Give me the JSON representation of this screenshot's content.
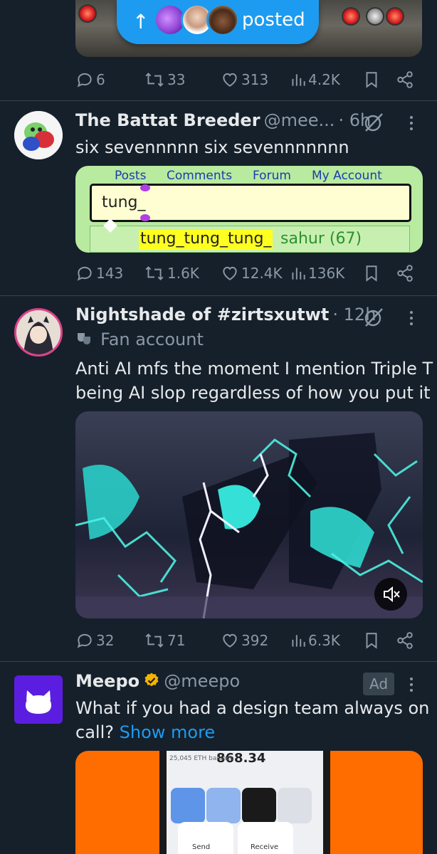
{
  "banner": {
    "label": "posted",
    "arrow": "↑"
  },
  "tweets": [
    {
      "stats": {
        "replies": "6",
        "reposts": "33",
        "likes": "313",
        "views": "4.2K"
      }
    },
    {
      "name": "The Battat Breeder",
      "handle": "@mee...",
      "time": "· 6h",
      "text": "six sevennnnn six sevennnnnnn",
      "embed": {
        "nav": [
          "Posts",
          "Comments",
          "Forum",
          "My Account"
        ],
        "query": "tung_",
        "suggestion_highlight": "tung_tung_tung_",
        "suggestion_rest": "sahur (67)"
      },
      "stats": {
        "replies": "143",
        "reposts": "1.6K",
        "likes": "12.4K",
        "views": "136K"
      }
    },
    {
      "name": "Nightshade of #zirtsxutwt",
      "time": "· 12h",
      "badge": "Fan account",
      "text_line1": "Anti AI mfs the moment I mention Triple T",
      "text_line2": "being AI slop regardless of how you put it",
      "stats": {
        "replies": "32",
        "reposts": "71",
        "likes": "392",
        "views": "6.3K"
      }
    },
    {
      "name": "Meepo",
      "handle": "@meepo",
      "ad": "Ad",
      "text_line1": "What if you had a design team always on",
      "text_line2": "call?",
      "show_more": "Show more",
      "media": {
        "amount": "868.34",
        "balance": "25,045 ETH balance",
        "send": "Send",
        "receive": "Receive"
      }
    }
  ],
  "icons": {
    "reply": "reply-icon",
    "repost": "repost-icon",
    "like": "heart-icon",
    "views": "views-icon",
    "bookmark": "bookmark-icon",
    "share": "share-icon",
    "grok": "grok-icon",
    "more": "more-icon",
    "mute": "mute-icon",
    "verified": "verified-badge-icon"
  },
  "colors": {
    "background": "#15202b",
    "accent": "#1d9bf0",
    "muted": "#8b98a5",
    "divider": "#38444d",
    "verified": "#f4b400"
  }
}
